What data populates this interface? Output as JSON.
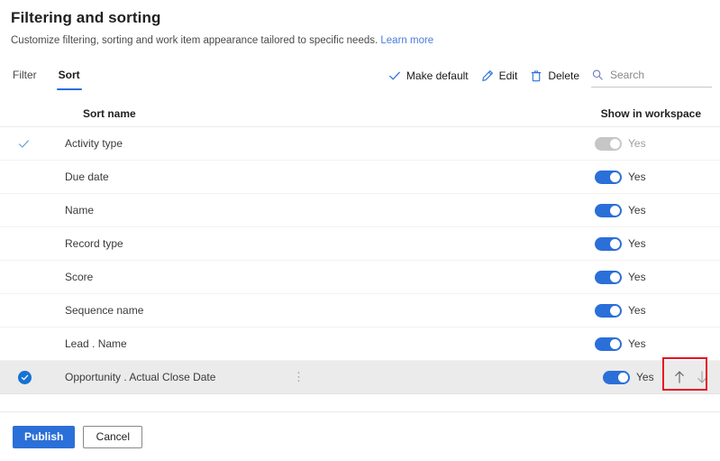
{
  "header": {
    "title": "Filtering and sorting",
    "subtitle": "Customize filtering, sorting and work item appearance tailored to specific needs.",
    "learn_more": "Learn more"
  },
  "tabs": [
    {
      "label": "Filter",
      "active": false
    },
    {
      "label": "Sort",
      "active": true
    }
  ],
  "commandbar": {
    "make_default": "Make default",
    "edit": "Edit",
    "delete": "Delete",
    "search_placeholder": "Search"
  },
  "table": {
    "columns": {
      "name": "Sort name",
      "show_in_workspace": "Show in workspace"
    },
    "rows": [
      {
        "name": "Activity type",
        "is_default": true,
        "selected": false,
        "toggle_on": true,
        "toggle_disabled": true,
        "toggle_label": "Yes",
        "show_more": false,
        "show_reorder": false
      },
      {
        "name": "Due date",
        "is_default": false,
        "selected": false,
        "toggle_on": true,
        "toggle_disabled": false,
        "toggle_label": "Yes",
        "show_more": false,
        "show_reorder": false
      },
      {
        "name": "Name",
        "is_default": false,
        "selected": false,
        "toggle_on": true,
        "toggle_disabled": false,
        "toggle_label": "Yes",
        "show_more": false,
        "show_reorder": false
      },
      {
        "name": "Record type",
        "is_default": false,
        "selected": false,
        "toggle_on": true,
        "toggle_disabled": false,
        "toggle_label": "Yes",
        "show_more": false,
        "show_reorder": false
      },
      {
        "name": "Score",
        "is_default": false,
        "selected": false,
        "toggle_on": true,
        "toggle_disabled": false,
        "toggle_label": "Yes",
        "show_more": false,
        "show_reorder": false
      },
      {
        "name": "Sequence name",
        "is_default": false,
        "selected": false,
        "toggle_on": true,
        "toggle_disabled": false,
        "toggle_label": "Yes",
        "show_more": false,
        "show_reorder": false
      },
      {
        "name": "Lead . Name",
        "is_default": false,
        "selected": false,
        "toggle_on": true,
        "toggle_disabled": false,
        "toggle_label": "Yes",
        "show_more": false,
        "show_reorder": false
      },
      {
        "name": "Opportunity . Actual Close Date",
        "is_default": false,
        "selected": true,
        "toggle_on": true,
        "toggle_disabled": false,
        "toggle_label": "Yes",
        "show_more": true,
        "show_reorder": true
      }
    ]
  },
  "row_icons": {
    "more": "⋮",
    "move_up": "move-up-arrow-icon",
    "move_down": "move-down-arrow-icon"
  },
  "footer": {
    "publish": "Publish",
    "cancel": "Cancel"
  },
  "annotation": {
    "type": "highlight-rectangle",
    "color": "#e81123",
    "target": "reorder-arrows"
  },
  "colors": {
    "accent": "#2b6fd8",
    "link": "#4a7ddc",
    "toggle_on": "#2b6fd8",
    "toggle_disabled": "#c8c6c4",
    "selected_row": "#ebebeb",
    "annotation": "#e81123"
  }
}
